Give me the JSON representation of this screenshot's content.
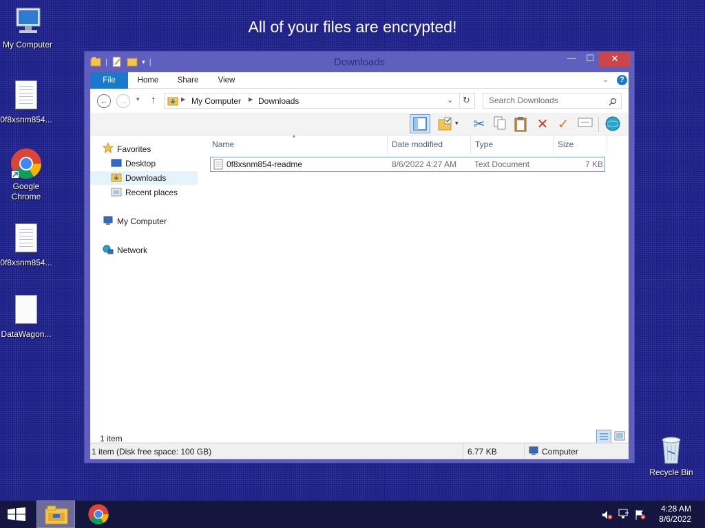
{
  "desktop": {
    "banner": "All of your files are encrypted!",
    "icons": [
      {
        "label": "My Computer",
        "icon": "computer-icon"
      },
      {
        "label": "0f8xsnm854...",
        "icon": "text-document-icon"
      },
      {
        "label": "Google Chrome",
        "icon": "chrome-icon"
      },
      {
        "label": "0f8xsnm854...",
        "icon": "text-document-icon"
      },
      {
        "label": "DataWagon...",
        "icon": "blank-document-icon"
      },
      {
        "label": "Recycle Bin",
        "icon": "recycle-bin-icon"
      }
    ]
  },
  "window": {
    "title": "Downloads",
    "controls": {
      "minimize": "—",
      "maximize": "☐",
      "close": "✕"
    },
    "ribbon_tabs": [
      "File",
      "Home",
      "Share",
      "View"
    ],
    "address": {
      "path": [
        "My Computer",
        "Downloads"
      ],
      "search_placeholder": "Search Downloads"
    },
    "nav_pane": {
      "favorites": "Favorites",
      "favorite_items": [
        "Desktop",
        "Downloads",
        "Recent places"
      ],
      "selected": "Downloads",
      "computer": "My Computer",
      "network": "Network"
    },
    "columns": [
      "Name",
      "Date modified",
      "Type",
      "Size"
    ],
    "files": [
      {
        "name": "0f8xsnm854-readme",
        "date_modified": "8/6/2022 4:27 AM",
        "type": "Text Document",
        "size": "7 KB"
      }
    ],
    "item_count": "1 item",
    "status": {
      "left": "1 item (Disk free space: 100 GB)",
      "size": "6.77 KB",
      "location": "Computer"
    }
  },
  "taskbar": {
    "time": "4:28 AM",
    "date": "8/6/2022",
    "pinned": [
      "windows-start-icon",
      "file-explorer-icon",
      "chrome-icon"
    ],
    "tray": [
      "speaker-muted-icon",
      "network-disconnected-icon",
      "action-center-flag-icon"
    ]
  },
  "colors": {
    "desktop_background": "#1c1f8a",
    "window_frame": "#5e5fbf",
    "file_tab": "#1979ca",
    "close_button": "#c9464a",
    "taskbar": "#14163f"
  }
}
